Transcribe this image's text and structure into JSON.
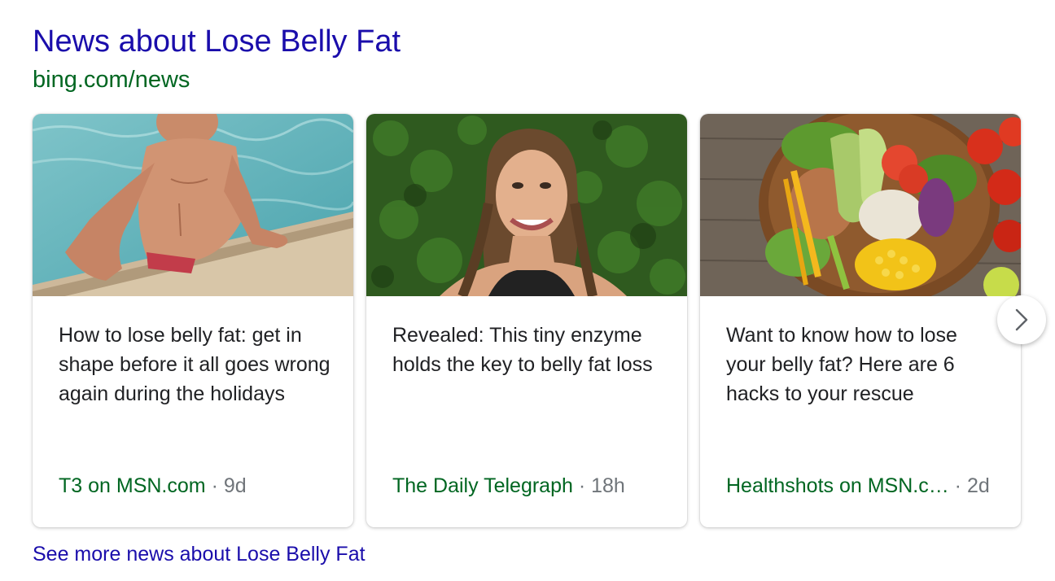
{
  "header": {
    "title": "News about Lose Belly Fat",
    "source": "bing.com/news"
  },
  "cards": [
    {
      "title": "How to lose belly fat: get in shape before it all goes wrong again during the holidays",
      "publisher": "T3 on MSN.com",
      "separator": "·",
      "age": "9d",
      "image": "man-in-swimming-pool"
    },
    {
      "title": "Revealed: This tiny enzyme holds the key to belly fat loss",
      "publisher": "The Daily Telegraph",
      "separator": "·",
      "age": "18h",
      "image": "smiling-woman-green-background"
    },
    {
      "title": "Want to know how to lose your belly fat? Here are 6 hacks to your rescue",
      "publisher": "Healthshots on MSN.c…",
      "separator": "·",
      "age": "2d",
      "image": "salad-bowl"
    }
  ],
  "footer": {
    "see_more": "See more news about Lose Belly Fat"
  },
  "icons": {
    "next": "chevron-right-icon"
  },
  "colors": {
    "link": "#1a0dab",
    "source_green": "#006621",
    "meta_gray": "#70757a",
    "text": "#202124"
  }
}
